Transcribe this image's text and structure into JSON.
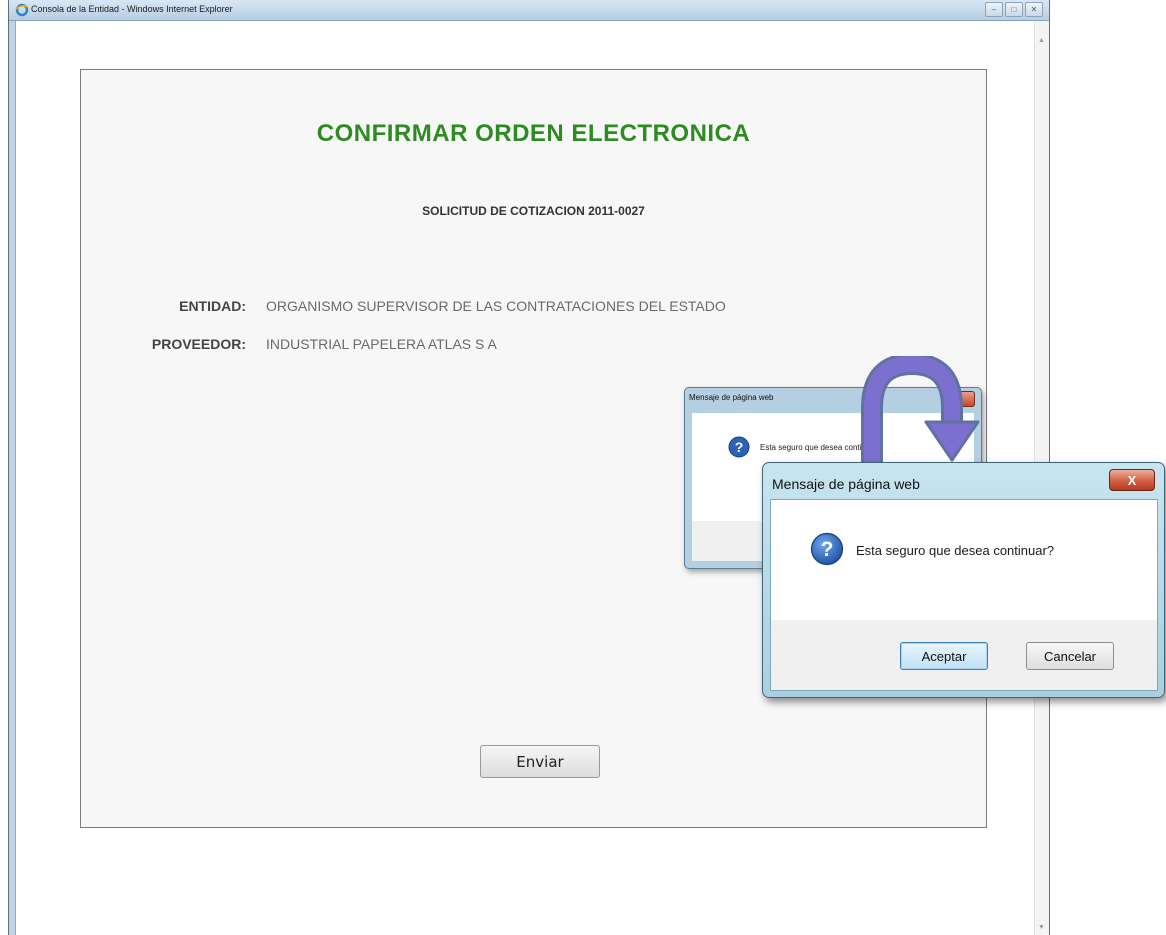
{
  "browser": {
    "window_title": "Consola de la Entidad - Windows Internet Explorer",
    "window_buttons": {
      "minimize": "–",
      "maximize": "□",
      "close": "✕"
    }
  },
  "form": {
    "title": "CONFIRMAR ORDEN ELECTRONICA",
    "subtitle": "SOLICITUD DE COTIZACION 2011-0027",
    "fields": [
      {
        "label": "ENTIDAD:",
        "value": "ORGANISMO SUPERVISOR DE LAS CONTRATACIONES DEL ESTADO"
      },
      {
        "label": "PROVEEDOR:",
        "value": "INDUSTRIAL PAPELERA ATLAS S A"
      }
    ],
    "submit_label": "Enviar"
  },
  "dialog_small": {
    "title": "Mensaje de página web",
    "close_label": "x",
    "message": "Esta seguro que desea continuar?"
  },
  "dialog_main": {
    "title": "Mensaje de página web",
    "close_label": "X",
    "message": "Esta seguro que desea continuar?",
    "ok_label": "Aceptar",
    "cancel_label": "Cancelar"
  },
  "colors": {
    "title_green": "#2e8b22",
    "dialog_frame": "#a9cfe0",
    "arrow_purple": "#7b6fd0",
    "question_icon_blue": "#2a63b8"
  },
  "icons": [
    "ie-logo-icon",
    "question-icon",
    "close-icon",
    "curved-arrow-icon"
  ]
}
